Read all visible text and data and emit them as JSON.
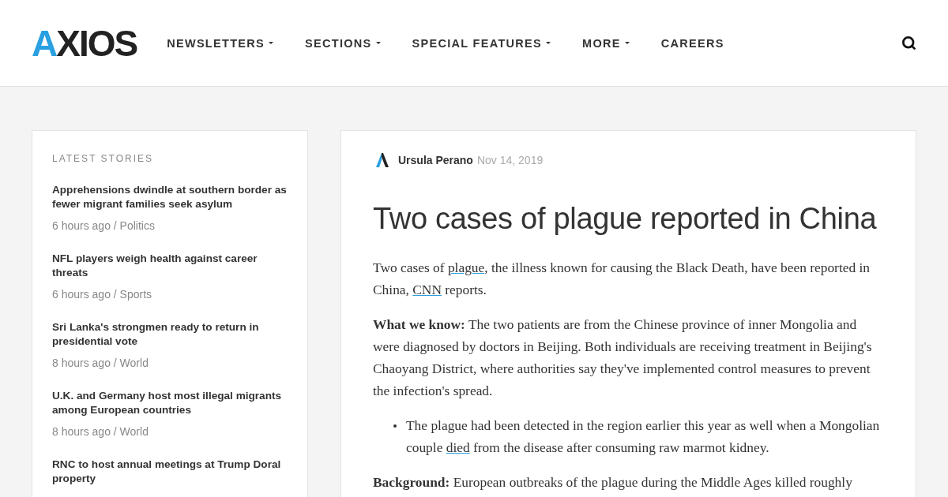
{
  "header": {
    "logo": "AXIOS",
    "nav": [
      {
        "label": "NEWSLETTERS",
        "dropdown": true
      },
      {
        "label": "SECTIONS",
        "dropdown": true
      },
      {
        "label": "SPECIAL FEATURES",
        "dropdown": true
      },
      {
        "label": "MORE",
        "dropdown": true
      },
      {
        "label": "CAREERS",
        "dropdown": false
      }
    ]
  },
  "sidebar": {
    "title": "LATEST STORIES",
    "stories": [
      {
        "headline": "Apprehensions dwindle at southern border as fewer migrant families seek asylum",
        "meta": "6 hours ago / Politics"
      },
      {
        "headline": "NFL players weigh health against career threats",
        "meta": "6 hours ago / Sports"
      },
      {
        "headline": "Sri Lanka's strongmen ready to return in presidential vote",
        "meta": "8 hours ago / World"
      },
      {
        "headline": "U.K. and Germany host most illegal migrants among European countries",
        "meta": "8 hours ago / World"
      },
      {
        "headline": "RNC to host annual meetings at Trump Doral property"
      }
    ]
  },
  "article": {
    "author": "Ursula Perano",
    "date": "Nov 14, 2019",
    "title": "Two cases of plague reported in China",
    "blocks": [
      {
        "kind": "paragraph",
        "segments": [
          {
            "text": "Two cases of ",
            "link": false
          },
          {
            "text": "plague",
            "link": true
          },
          {
            "text": ", the illness known for causing the Black Death, have been reported in China, ",
            "link": false
          },
          {
            "text": "CNN",
            "link": true
          },
          {
            "text": " reports.",
            "link": false
          }
        ]
      },
      {
        "kind": "paragraph",
        "segments": [
          {
            "text": "**What we know:** The two patients are from the Chinese province of inner Mongolia and were diagnosed by doctors in Beijing. Both individuals are receiving treatment in Beijing's Chaoyang District, where authorities say they've implemented control measures to prevent the infection's spread.",
            "link": false
          }
        ]
      },
      {
        "kind": "bullet",
        "segments": [
          {
            "text": "The plague had been detected in the region earlier this year as well when a Mongolian couple ",
            "link": false
          },
          {
            "text": "died",
            "link": true
          },
          {
            "text": " from the disease after consuming raw marmot kidney.",
            "link": false
          }
        ]
      },
      {
        "kind": "paragraph",
        "segments": [
          {
            "text": "**Background:** European outbreaks of the plague during the Middle Ages killed roughly",
            "link": false
          }
        ]
      }
    ]
  }
}
